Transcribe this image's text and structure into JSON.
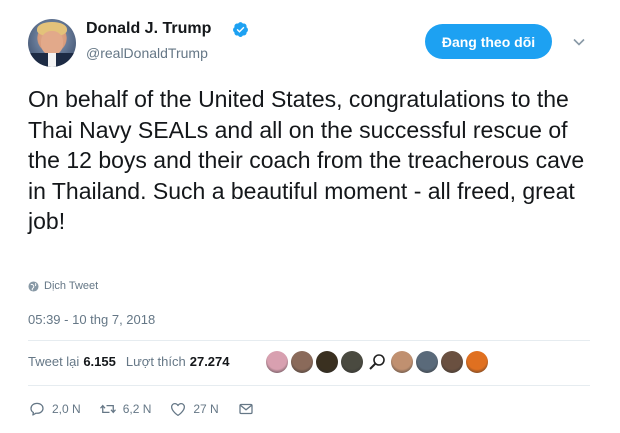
{
  "author": {
    "name": "Donald J. Trump",
    "handle": "@realDonaldTrump",
    "verified": true
  },
  "header": {
    "follow_label": "Đang theo dõi"
  },
  "tweet": {
    "text": "On behalf of the United States, congratulations to the Thai Navy SEALs and all on the successful rescue of the 12 boys and their coach from the treacherous cave in Thailand. Such a beautiful moment - all freed, great job!",
    "translate_label": "Dịch Tweet",
    "timestamp": "05:39 - 10 thg 7, 2018"
  },
  "stats": {
    "retweets_label": "Tweet lại",
    "retweets_count": "6.155",
    "likes_label": "Lượt thích",
    "likes_count": "27.274"
  },
  "likers": [
    {
      "color": "#d8a0b0"
    },
    {
      "color": "#8a6a5a"
    },
    {
      "color": "#3a3020"
    },
    {
      "color": "#4a4a40"
    },
    {
      "color": "search"
    },
    {
      "color": "#c09070"
    },
    {
      "color": "#5a6a7a"
    },
    {
      "color": "#6a5040"
    },
    {
      "color": "#e07020"
    }
  ],
  "actions": {
    "reply_count": "2,0 N",
    "retweet_count": "6,2 N",
    "like_count": "27 N"
  },
  "colors": {
    "accent": "#1da1f2",
    "muted": "#657786",
    "text": "#14171a"
  },
  "icons": {
    "verified": "verified-badge-icon",
    "chevron": "chevron-down-icon",
    "globe": "globe-icon",
    "reply": "reply-icon",
    "retweet": "retweet-icon",
    "like": "heart-icon",
    "message": "envelope-icon"
  }
}
